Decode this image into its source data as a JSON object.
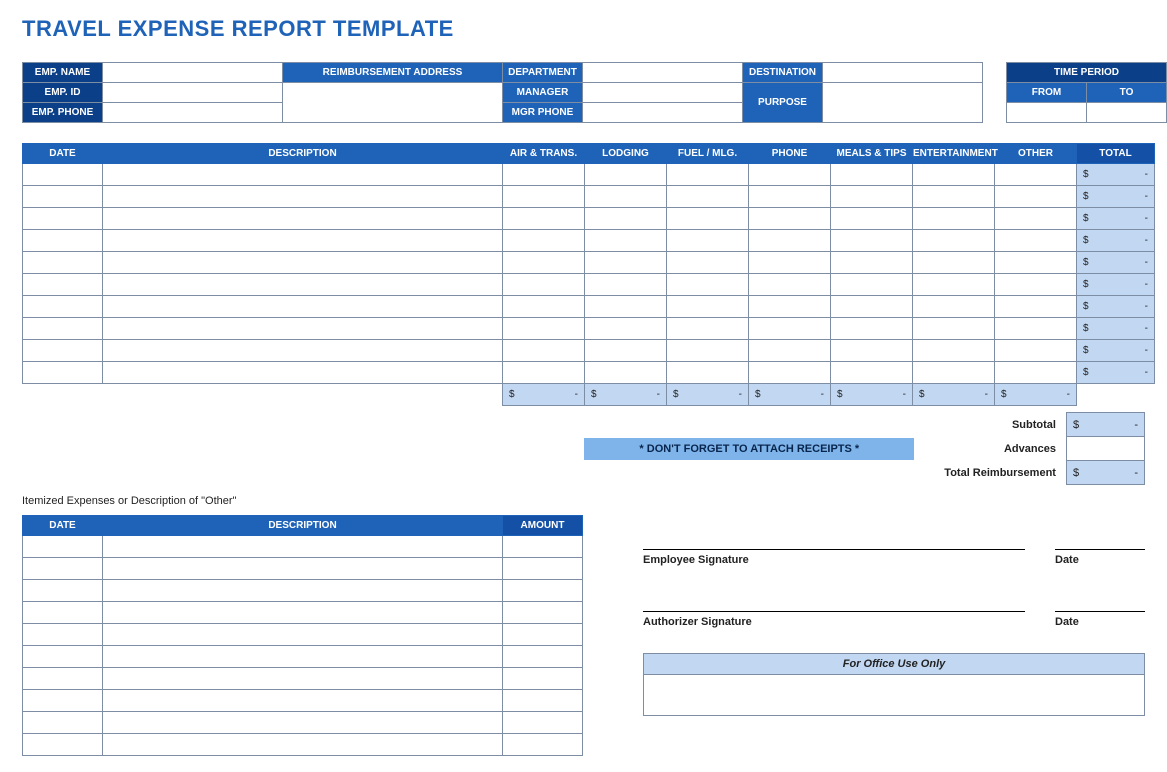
{
  "title": "TRAVEL EXPENSE REPORT TEMPLATE",
  "info": {
    "emp_name_lbl": "EMP. NAME",
    "emp_id_lbl": "EMP. ID",
    "emp_phone_lbl": "EMP. PHONE",
    "reimb_addr_lbl": "REIMBURSEMENT ADDRESS",
    "dept_lbl": "DEPARTMENT",
    "manager_lbl": "MANAGER",
    "mgr_phone_lbl": "MGR PHONE",
    "dest_lbl": "DESTINATION",
    "purpose_lbl": "PURPOSE",
    "time_period_lbl": "TIME PERIOD",
    "from_lbl": "FROM",
    "to_lbl": "TO",
    "emp_name": "",
    "emp_id": "",
    "emp_phone": "",
    "reimb_addr": "",
    "dept": "",
    "manager": "",
    "mgr_phone": "",
    "dest": "",
    "purpose": "",
    "from": "",
    "to": ""
  },
  "columns": {
    "date": "DATE",
    "desc": "DESCRIPTION",
    "air": "AIR & TRANS.",
    "lodging": "LODGING",
    "fuel": "FUEL / MLG.",
    "phone": "PHONE",
    "meals": "MEALS & TIPS",
    "ent": "ENTERTAINMENT",
    "other": "OTHER",
    "total": "TOTAL"
  },
  "row_total": {
    "currency": "$",
    "dash": "-"
  },
  "summary": {
    "subtotal_lbl": "Subtotal",
    "advances_lbl": "Advances",
    "total_reimb_lbl": "Total Reimbursement",
    "receipts_msg": "* DON'T FORGET TO ATTACH RECEIPTS *",
    "subtotal": {
      "currency": "$",
      "dash": "-"
    },
    "advances": "",
    "total_reimb": {
      "currency": "$",
      "dash": "-"
    }
  },
  "other_section": {
    "caption": "Itemized Expenses or Description of \"Other\"",
    "date_lbl": "DATE",
    "desc_lbl": "DESCRIPTION",
    "amt_lbl": "AMOUNT"
  },
  "sig": {
    "emp_sig_lbl": "Employee Signature",
    "auth_sig_lbl": "Authorizer Signature",
    "date_lbl": "Date",
    "office_lbl": "For Office Use Only"
  }
}
